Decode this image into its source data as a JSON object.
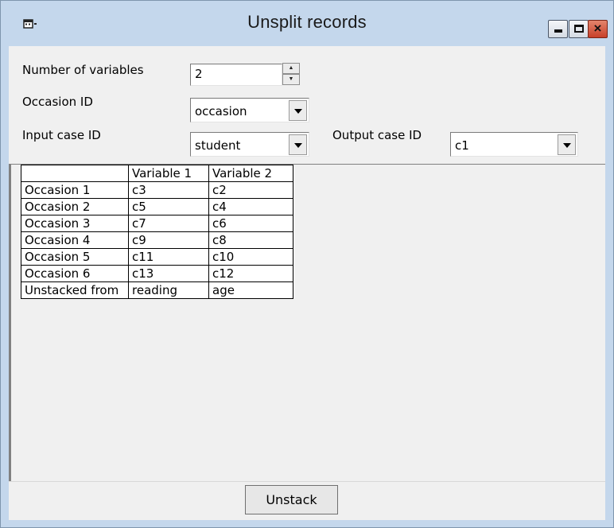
{
  "window": {
    "title": "Unsplit records",
    "controls": {
      "minimize": "minimize-icon",
      "maximize": "maximize-icon",
      "close": "×"
    }
  },
  "form": {
    "num_variables_label": "Number of variables",
    "num_variables_value": "2",
    "occasion_id_label": "Occasion ID",
    "occasion_id_value": "occasion",
    "input_case_id_label": "Input case ID",
    "input_case_id_value": "student",
    "output_case_id_label": "Output case ID",
    "output_case_id_value": "c1"
  },
  "grid": {
    "headers": [
      "",
      "Variable  1",
      "Variable  2"
    ],
    "rows": [
      [
        "Occasion 1",
        "c3",
        "c2"
      ],
      [
        "Occasion 2",
        "c5",
        "c4"
      ],
      [
        "Occasion 3",
        "c7",
        "c6"
      ],
      [
        "Occasion 4",
        "c9",
        "c8"
      ],
      [
        "Occasion 5",
        "c11",
        "c10"
      ],
      [
        "Occasion 6",
        "c13",
        "c12"
      ],
      [
        "Unstacked from",
        "reading",
        "age"
      ]
    ]
  },
  "actions": {
    "unstack_label": "Unstack"
  },
  "colors": {
    "titlebar": "#c4d7ec",
    "client": "#f0f0f0",
    "close_button": "#c8402a"
  }
}
